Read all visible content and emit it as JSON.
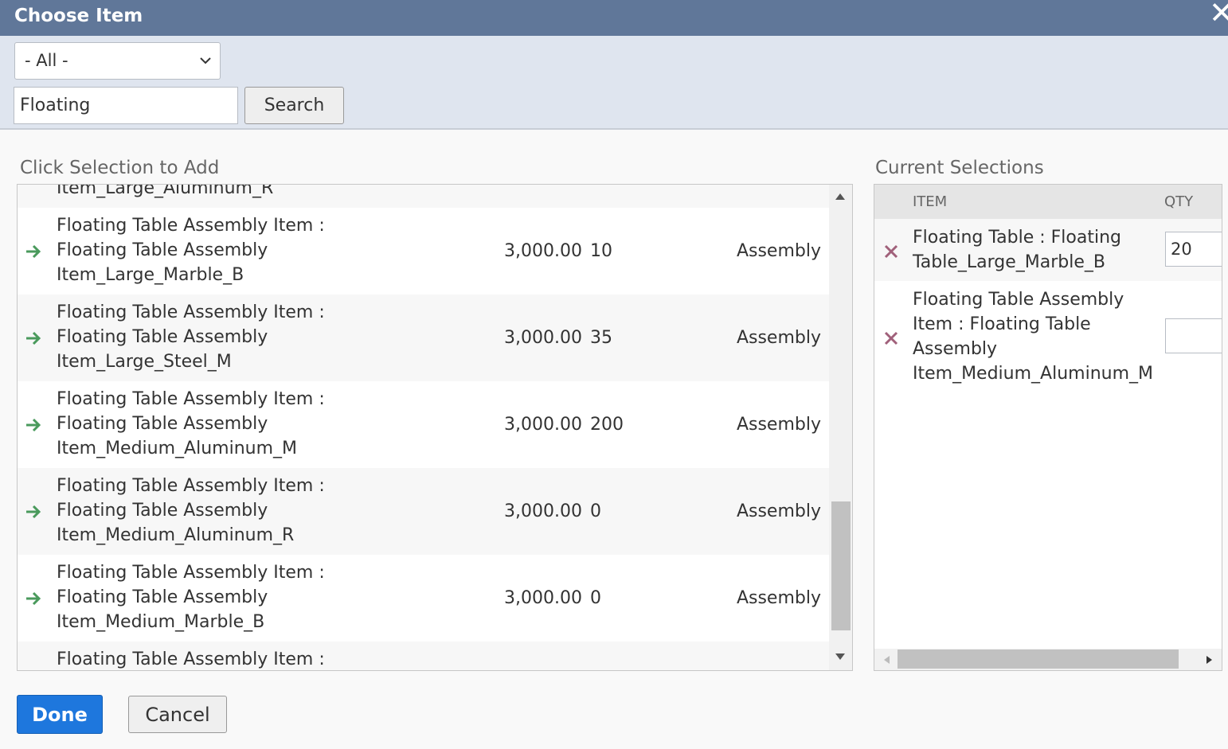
{
  "window": {
    "title": "Choose Item"
  },
  "filter": {
    "select_value": "- All -",
    "search_value": "Floating",
    "search_label": "Search"
  },
  "left_section": {
    "title": "Click Selection to Add",
    "rows": [
      {
        "name_lines": [
          "",
          "",
          "Item_Large_Aluminum_R"
        ],
        "price": "",
        "qty": "",
        "type": ""
      },
      {
        "name_lines": [
          "Floating Table Assembly Item :",
          "Floating Table Assembly",
          "Item_Large_Marble_B"
        ],
        "price": "3,000.00",
        "qty": "10",
        "type": "Assembly"
      },
      {
        "name_lines": [
          "Floating Table Assembly Item :",
          "Floating Table Assembly",
          "Item_Large_Steel_M"
        ],
        "price": "3,000.00",
        "qty": "35",
        "type": "Assembly"
      },
      {
        "name_lines": [
          "Floating Table Assembly Item :",
          "Floating Table Assembly",
          "Item_Medium_Aluminum_M"
        ],
        "price": "3,000.00",
        "qty": "200",
        "type": "Assembly"
      },
      {
        "name_lines": [
          "Floating Table Assembly Item :",
          "Floating Table Assembly",
          "Item_Medium_Aluminum_R"
        ],
        "price": "3,000.00",
        "qty": "0",
        "type": "Assembly"
      },
      {
        "name_lines": [
          "Floating Table Assembly Item :",
          "Floating Table Assembly",
          "Item_Medium_Marble_B"
        ],
        "price": "3,000.00",
        "qty": "0",
        "type": "Assembly"
      },
      {
        "name_lines": [
          "Floating Table Assembly Item :",
          "",
          ""
        ],
        "price": "",
        "qty": "",
        "type": ""
      }
    ]
  },
  "right_section": {
    "title": "Current Selections",
    "col_item": "ITEM",
    "col_qty": "QTY",
    "rows": [
      {
        "name_lines": [
          "Floating Table : Floating",
          "Table_Large_Marble_B"
        ],
        "qty": "20"
      },
      {
        "name_lines": [
          "Floating Table Assembly",
          "Item : Floating Table",
          "Assembly",
          "Item_Medium_Aluminum_M"
        ],
        "qty": ""
      }
    ]
  },
  "footer": {
    "done_label": "Done",
    "cancel_label": "Cancel"
  },
  "colors": {
    "titlebar": "#607799",
    "filterbar": "#dfe5ef",
    "add_arrow": "#4a9a5c",
    "remove_x": "#a0607a",
    "done_button": "#1e77dd"
  }
}
